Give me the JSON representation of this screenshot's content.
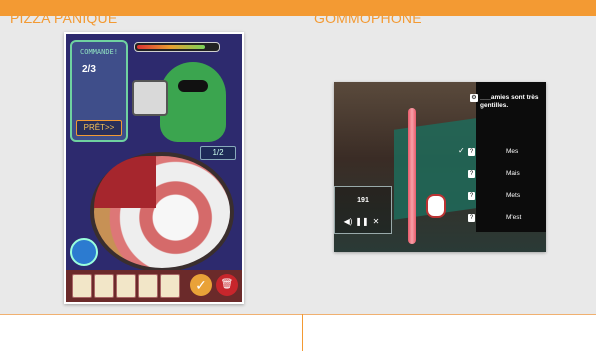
{
  "captions": {
    "left": "PIZZA PANIQUE",
    "right": "GOMMOPHONE"
  },
  "pizza": {
    "orders_title": "COMMANDE!",
    "orders_count": "2/3",
    "ready_label": "PRÊT>>",
    "progress": "1/2",
    "meter_level": 0.85
  },
  "gommophone": {
    "question": "___amies sont très gentilles.",
    "score": "191",
    "options": [
      "Mes",
      "Mais",
      "Mets",
      "M'est"
    ],
    "selected_index": 0
  },
  "colors": {
    "accent": "#f39a33"
  }
}
